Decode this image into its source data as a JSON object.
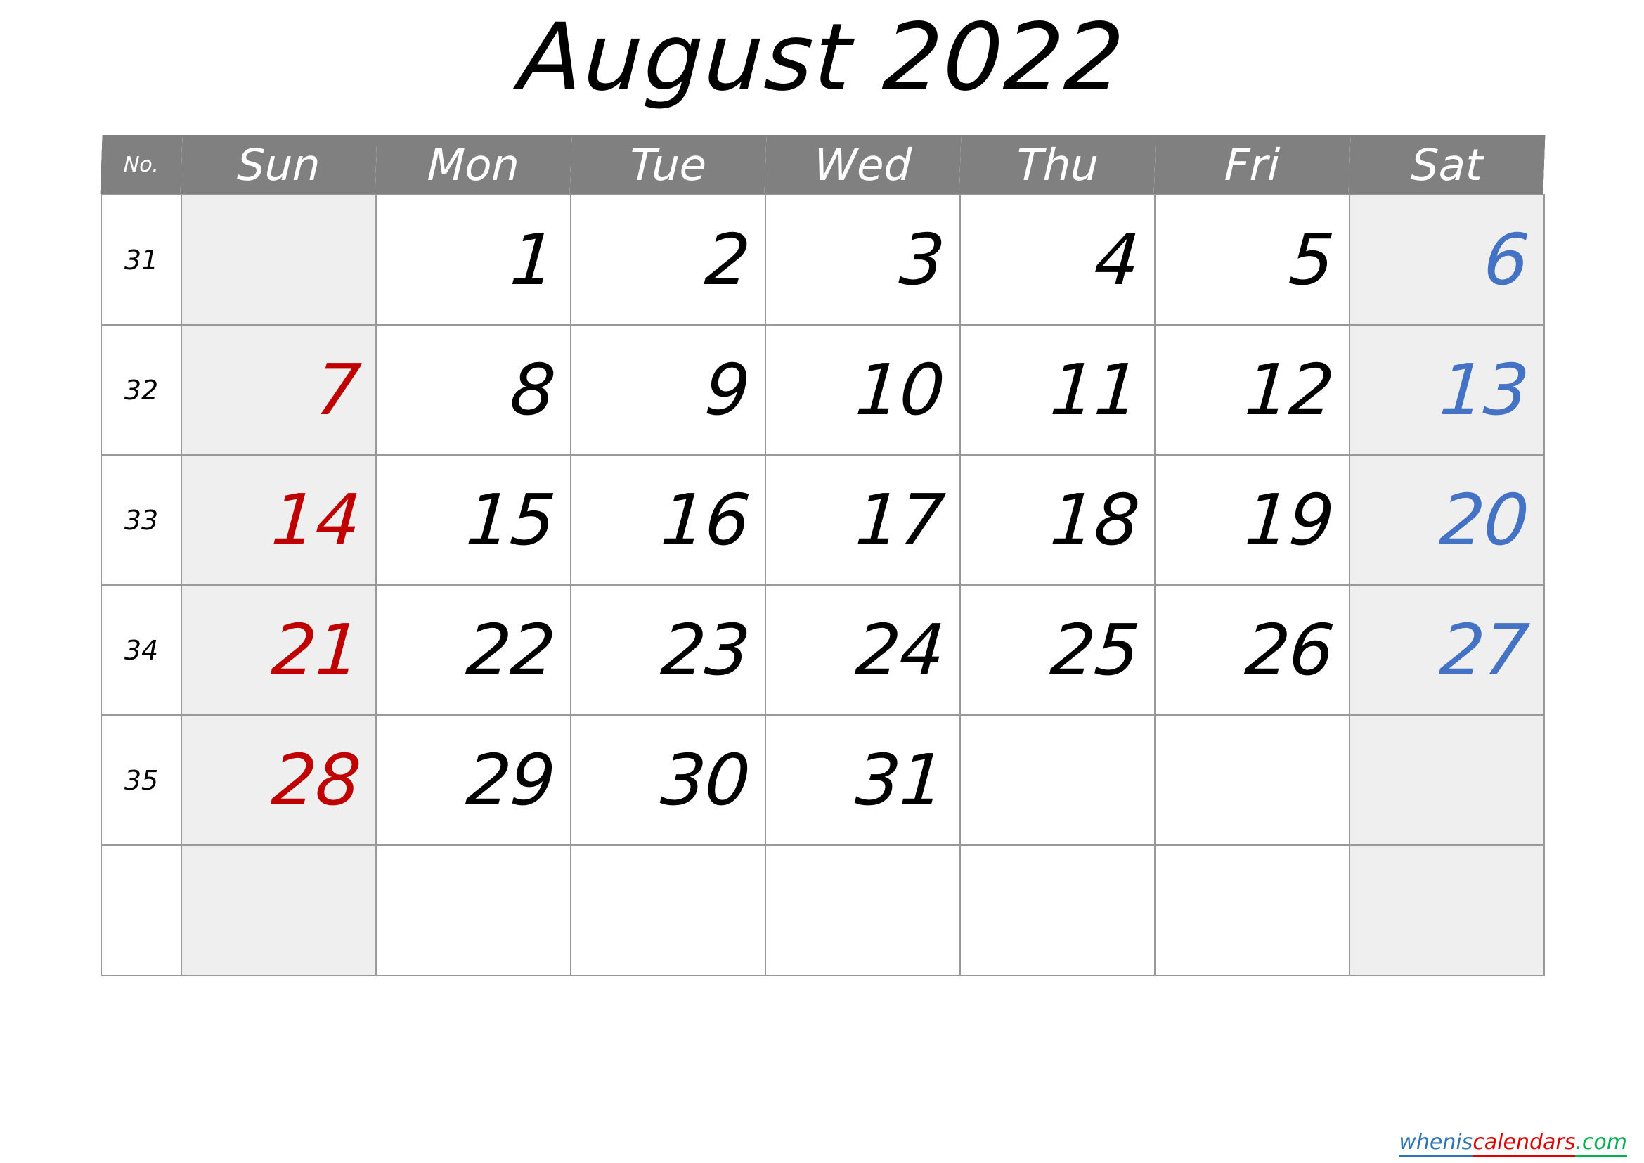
{
  "title": "August 2022",
  "header": {
    "week_no_label": "No.",
    "days": [
      "Sun",
      "Mon",
      "Tue",
      "Wed",
      "Thu",
      "Fri",
      "Sat"
    ]
  },
  "colors": {
    "header_bg": "#808080",
    "header_text": "#ffffff",
    "weekend_cell_bg": "#efefef",
    "weekday_cell_bg": "#ffffff",
    "sunday_text": "#c00000",
    "saturday_text": "#4472c4",
    "weekday_text": "#000000",
    "grid_line": "#999999",
    "watermark_blue": "#2e75b6",
    "watermark_red": "#e00000",
    "watermark_green": "#00b050"
  },
  "weeks": [
    {
      "no": "31",
      "days": [
        {
          "label": "",
          "kind": "sun"
        },
        {
          "label": "1",
          "kind": "weekday"
        },
        {
          "label": "2",
          "kind": "weekday"
        },
        {
          "label": "3",
          "kind": "weekday"
        },
        {
          "label": "4",
          "kind": "weekday"
        },
        {
          "label": "5",
          "kind": "weekday"
        },
        {
          "label": "6",
          "kind": "sat"
        }
      ]
    },
    {
      "no": "32",
      "days": [
        {
          "label": "7",
          "kind": "sun"
        },
        {
          "label": "8",
          "kind": "weekday"
        },
        {
          "label": "9",
          "kind": "weekday"
        },
        {
          "label": "10",
          "kind": "weekday"
        },
        {
          "label": "11",
          "kind": "weekday"
        },
        {
          "label": "12",
          "kind": "weekday"
        },
        {
          "label": "13",
          "kind": "sat"
        }
      ]
    },
    {
      "no": "33",
      "days": [
        {
          "label": "14",
          "kind": "sun"
        },
        {
          "label": "15",
          "kind": "weekday"
        },
        {
          "label": "16",
          "kind": "weekday"
        },
        {
          "label": "17",
          "kind": "weekday"
        },
        {
          "label": "18",
          "kind": "weekday"
        },
        {
          "label": "19",
          "kind": "weekday"
        },
        {
          "label": "20",
          "kind": "sat"
        }
      ]
    },
    {
      "no": "34",
      "days": [
        {
          "label": "21",
          "kind": "sun"
        },
        {
          "label": "22",
          "kind": "weekday"
        },
        {
          "label": "23",
          "kind": "weekday"
        },
        {
          "label": "24",
          "kind": "weekday"
        },
        {
          "label": "25",
          "kind": "weekday"
        },
        {
          "label": "26",
          "kind": "weekday"
        },
        {
          "label": "27",
          "kind": "sat"
        }
      ]
    },
    {
      "no": "35",
      "days": [
        {
          "label": "28",
          "kind": "sun"
        },
        {
          "label": "29",
          "kind": "weekday"
        },
        {
          "label": "30",
          "kind": "weekday"
        },
        {
          "label": "31",
          "kind": "weekday"
        },
        {
          "label": "",
          "kind": "weekday"
        },
        {
          "label": "",
          "kind": "weekday"
        },
        {
          "label": "",
          "kind": "sat"
        }
      ]
    },
    {
      "no": "",
      "days": [
        {
          "label": "",
          "kind": "sun"
        },
        {
          "label": "",
          "kind": "weekday"
        },
        {
          "label": "",
          "kind": "weekday"
        },
        {
          "label": "",
          "kind": "weekday"
        },
        {
          "label": "",
          "kind": "weekday"
        },
        {
          "label": "",
          "kind": "weekday"
        },
        {
          "label": "",
          "kind": "sat"
        }
      ]
    }
  ],
  "watermark": {
    "part1": "whenis",
    "part2": "calendars",
    "part3": ".com"
  }
}
